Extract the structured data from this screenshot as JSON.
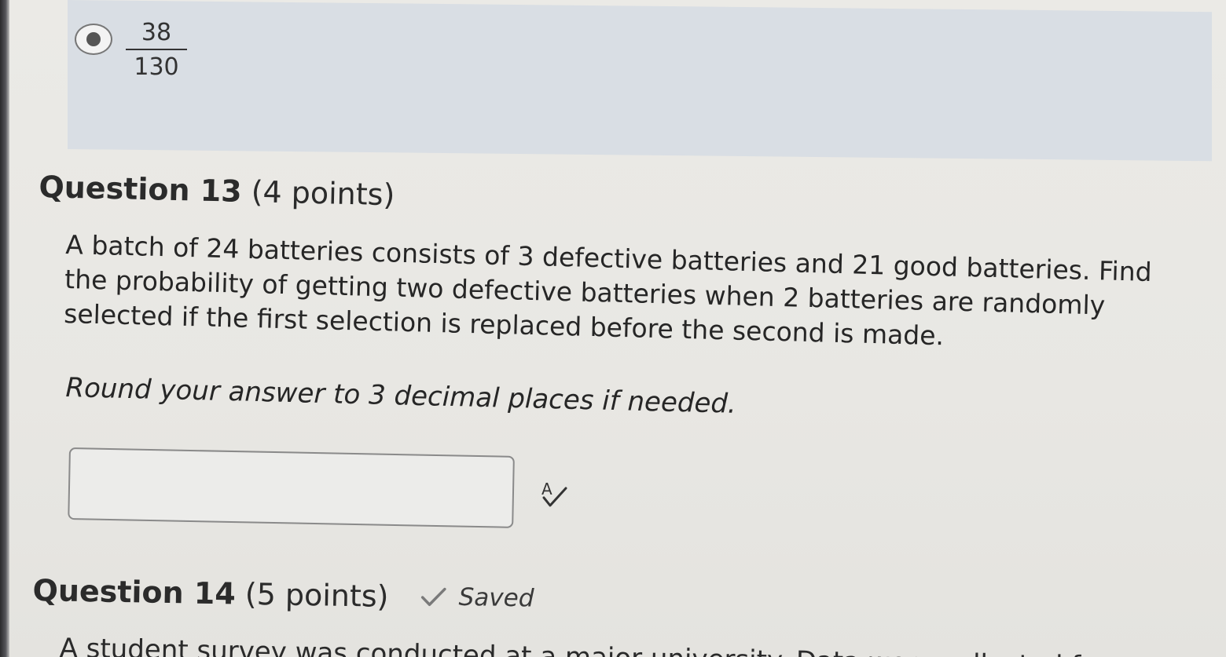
{
  "previous_question": {
    "selected_option": {
      "numerator": "38",
      "denominator": "130"
    }
  },
  "question13": {
    "number_label": "Question 13",
    "points_label": "(4 points)",
    "text_lines": [
      "A batch of 24 batteries consists of 3 defective batteries and 21 good batteries. Find",
      "the probability of getting two defective batteries when 2 batteries are randomly",
      "selected if the first selection is replaced before the second is made."
    ],
    "instruction": "Round your answer to 3 decimal places if needed.",
    "answer_value": "",
    "spellcheck_icon": "spellcheck-icon"
  },
  "question14": {
    "number_label": "Question 14",
    "points_label": "(5 points)",
    "saved_label": "Saved",
    "saved_icon": "checkmark-icon",
    "text_start": "A student survey was conducted at a major university. Data were collected from a"
  }
}
